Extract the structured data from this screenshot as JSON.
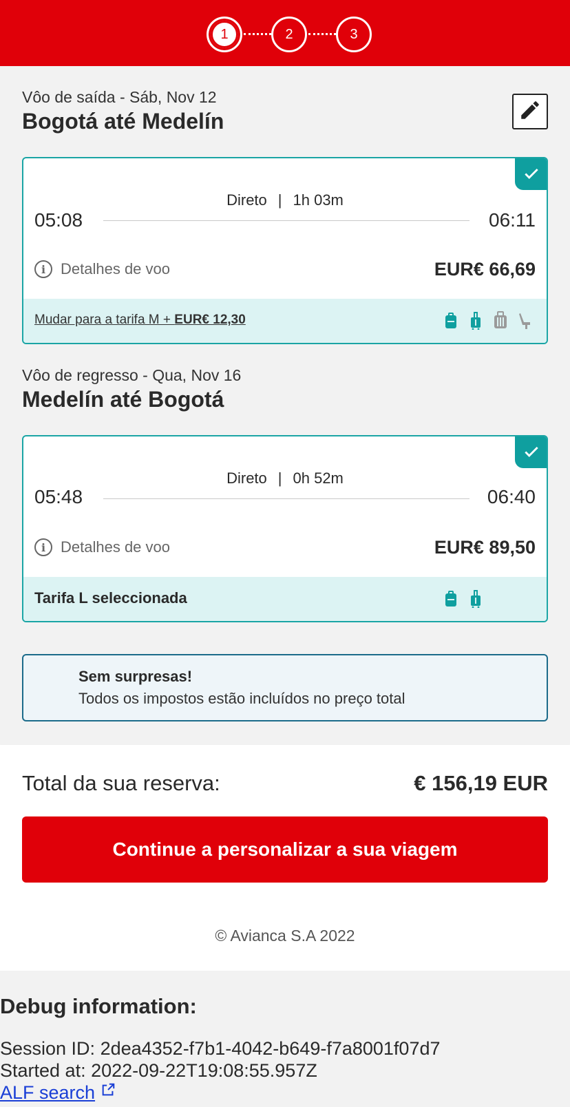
{
  "stepper": {
    "steps": [
      "1",
      "2",
      "3"
    ],
    "active_step": 1
  },
  "outbound": {
    "subtitle": "Vôo de saída - Sáb, Nov 12",
    "route": "Bogotá até Medelín",
    "flight_type": "Direto",
    "separator": "|",
    "duration": "1h 03m",
    "departure": "05:08",
    "arrival": "06:11",
    "details_label": "Detalhes de voo",
    "price": "EUR€ 66,69",
    "fare_prefix": "Mudar para a tarifa M + ",
    "fare_extra": "EUR€ 12,30",
    "fare_icons": [
      "backpack-icon",
      "carry-on-icon",
      "checked-bag-icon",
      "seat-icon"
    ]
  },
  "return": {
    "subtitle": "Vôo de regresso - Qua, Nov 16",
    "route": "Medelín até Bogotá",
    "flight_type": "Direto",
    "separator": "|",
    "duration": "0h 52m",
    "departure": "05:48",
    "arrival": "06:40",
    "details_label": "Detalhes de voo",
    "price": "EUR€ 89,50",
    "fare_selected": "Tarifa L seleccionada",
    "fare_icons": [
      "backpack-icon",
      "carry-on-icon"
    ]
  },
  "note": {
    "title": "Sem surpresas!",
    "text": "Todos os impostos estão incluídos no preço total"
  },
  "total": {
    "label": "Total da sua reserva:",
    "value": "€ 156,19 EUR",
    "cta": "Continue a personalizar a sua viagem"
  },
  "footer": {
    "copyright": "© Avianca S.A 2022"
  },
  "debug": {
    "title": "Debug information:",
    "session_label": "Session ID: ",
    "session_id": "2dea4352-f7b1-4042-b649-f7a8001f07d7",
    "started_label": "Started at: ",
    "started_at": "2022-09-22T19:08:55.957Z",
    "link": "ALF search"
  },
  "colors": {
    "brand_red": "#e00009",
    "teal": "#0f9f9f",
    "fare_bg": "#dcf3f3"
  }
}
